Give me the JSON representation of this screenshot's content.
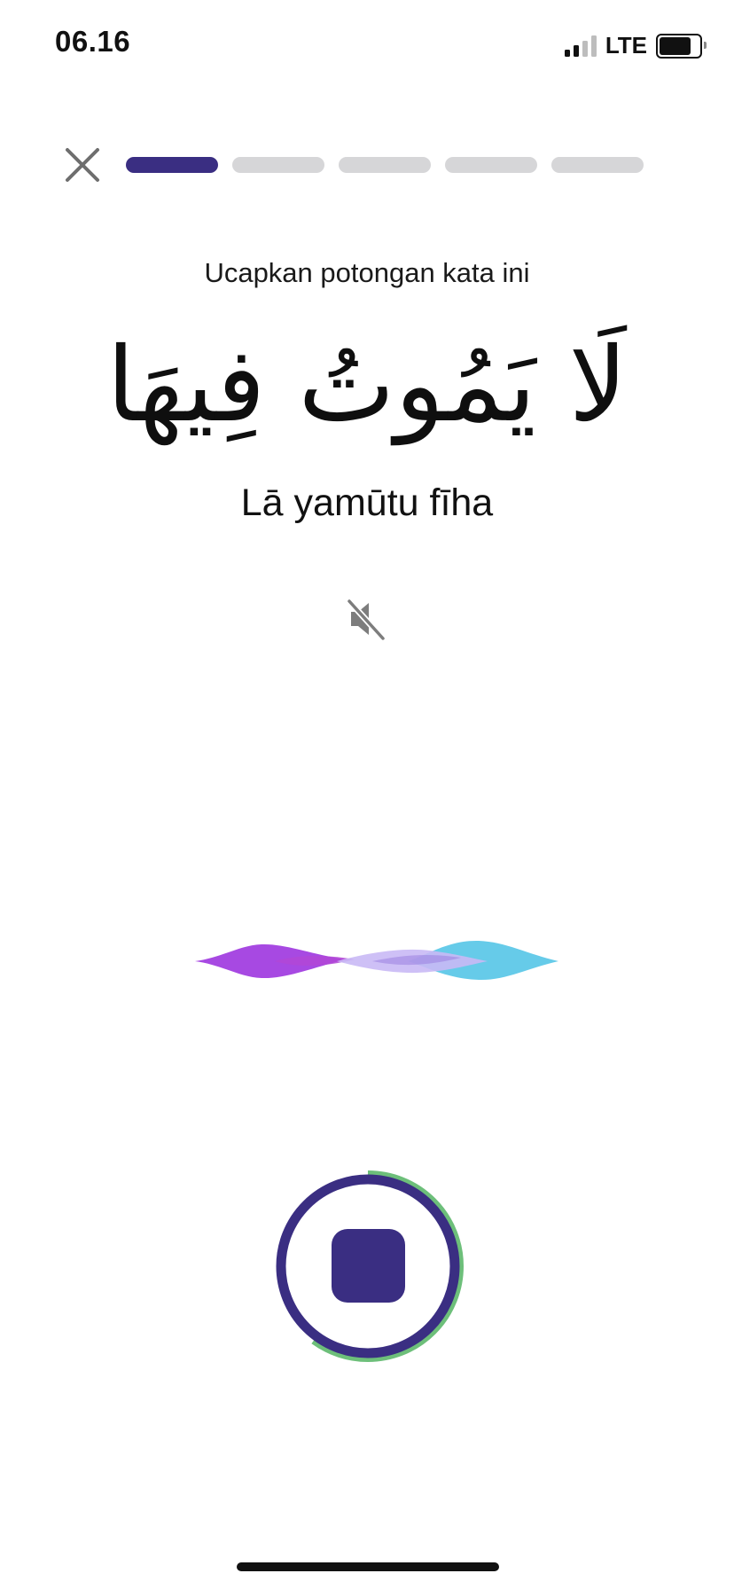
{
  "status_bar": {
    "time": "06.16",
    "network": "LTE",
    "signal_bars_active": 2,
    "signal_bars_total": 4,
    "battery_level": 0.8
  },
  "header": {
    "close_icon": "close-icon",
    "progress": {
      "total_steps": 5,
      "current_step": 1,
      "active_color": "#3a2e82",
      "inactive_color": "#d6d6d8"
    }
  },
  "lesson": {
    "prompt": "Ucapkan potongan kata ini",
    "arabic": "لَا يَمُوتُ فِيهَا",
    "transliteration": "Lā yamūtu fīha"
  },
  "audio": {
    "mute_icon": "speaker-muted-icon"
  },
  "waveform": {
    "colors": [
      "#a23fe0",
      "#5ec8e8",
      "#c9b9f5"
    ]
  },
  "record": {
    "icon": "stop-icon",
    "ring_color": "#3a2e82",
    "progress_color": "#6dbf7a",
    "progress": 0.6
  }
}
